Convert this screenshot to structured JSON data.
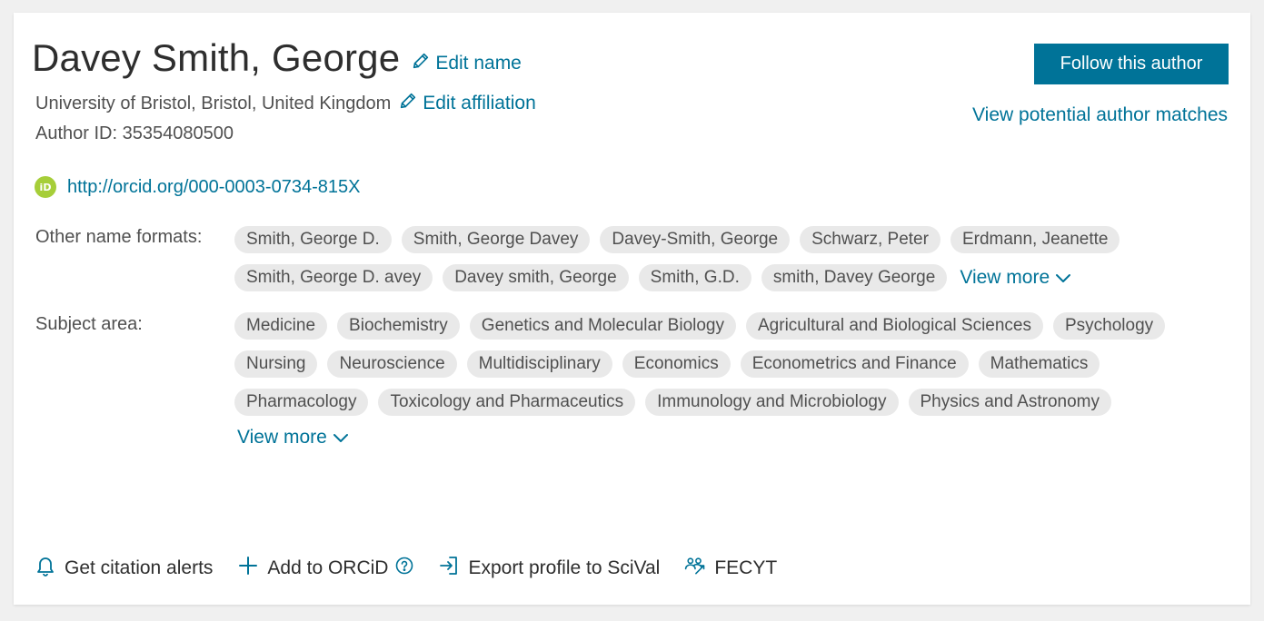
{
  "author": {
    "name": "Davey Smith, George",
    "edit_name_label": "Edit name",
    "affiliation": "University of Bristol, Bristol, United Kingdom",
    "edit_affiliation_label": "Edit affiliation",
    "author_id": "Author ID: 35354080500",
    "orcid_badge": "iD",
    "orcid_url": "http://orcid.org/000-0003-0734-815X"
  },
  "header_actions": {
    "follow_label": "Follow this author",
    "matches_label": "View potential author matches"
  },
  "name_formats": {
    "label": "Other name formats:",
    "items": [
      "Smith, George D.",
      "Smith, George Davey",
      "Davey-Smith, George",
      "Schwarz, Peter",
      "Erdmann, Jeanette",
      "Smith, George D. avey",
      "Davey smith, George",
      "Smith, G.D.",
      "smith, Davey George"
    ],
    "view_more_label": "View more"
  },
  "subject_area": {
    "label": "Subject area:",
    "items": [
      "Medicine",
      "Biochemistry",
      "Genetics and Molecular Biology",
      "Agricultural and Biological Sciences",
      "Psychology",
      "Nursing",
      "Neuroscience",
      "Multidisciplinary",
      "Economics",
      "Econometrics and Finance",
      "Mathematics",
      "Pharmacology",
      "Toxicology and Pharmaceutics",
      "Immunology and Microbiology",
      "Physics and Astronomy"
    ],
    "view_more_label": "View more"
  },
  "bottom_actions": {
    "citation_alerts": "Get citation alerts",
    "add_orcid": "Add to ORCiD",
    "export_scival": "Export profile to SciVal",
    "fecyt": "FECYT"
  },
  "colors": {
    "accent": "#007398",
    "chip_bg": "#e9e9e9",
    "orcid_green": "#a6ce39"
  },
  "icons": [
    "pencil-icon",
    "orcid-icon",
    "chevron-down-icon",
    "bell-icon",
    "plus-icon",
    "help-icon",
    "export-icon",
    "fecyt-icon"
  ]
}
